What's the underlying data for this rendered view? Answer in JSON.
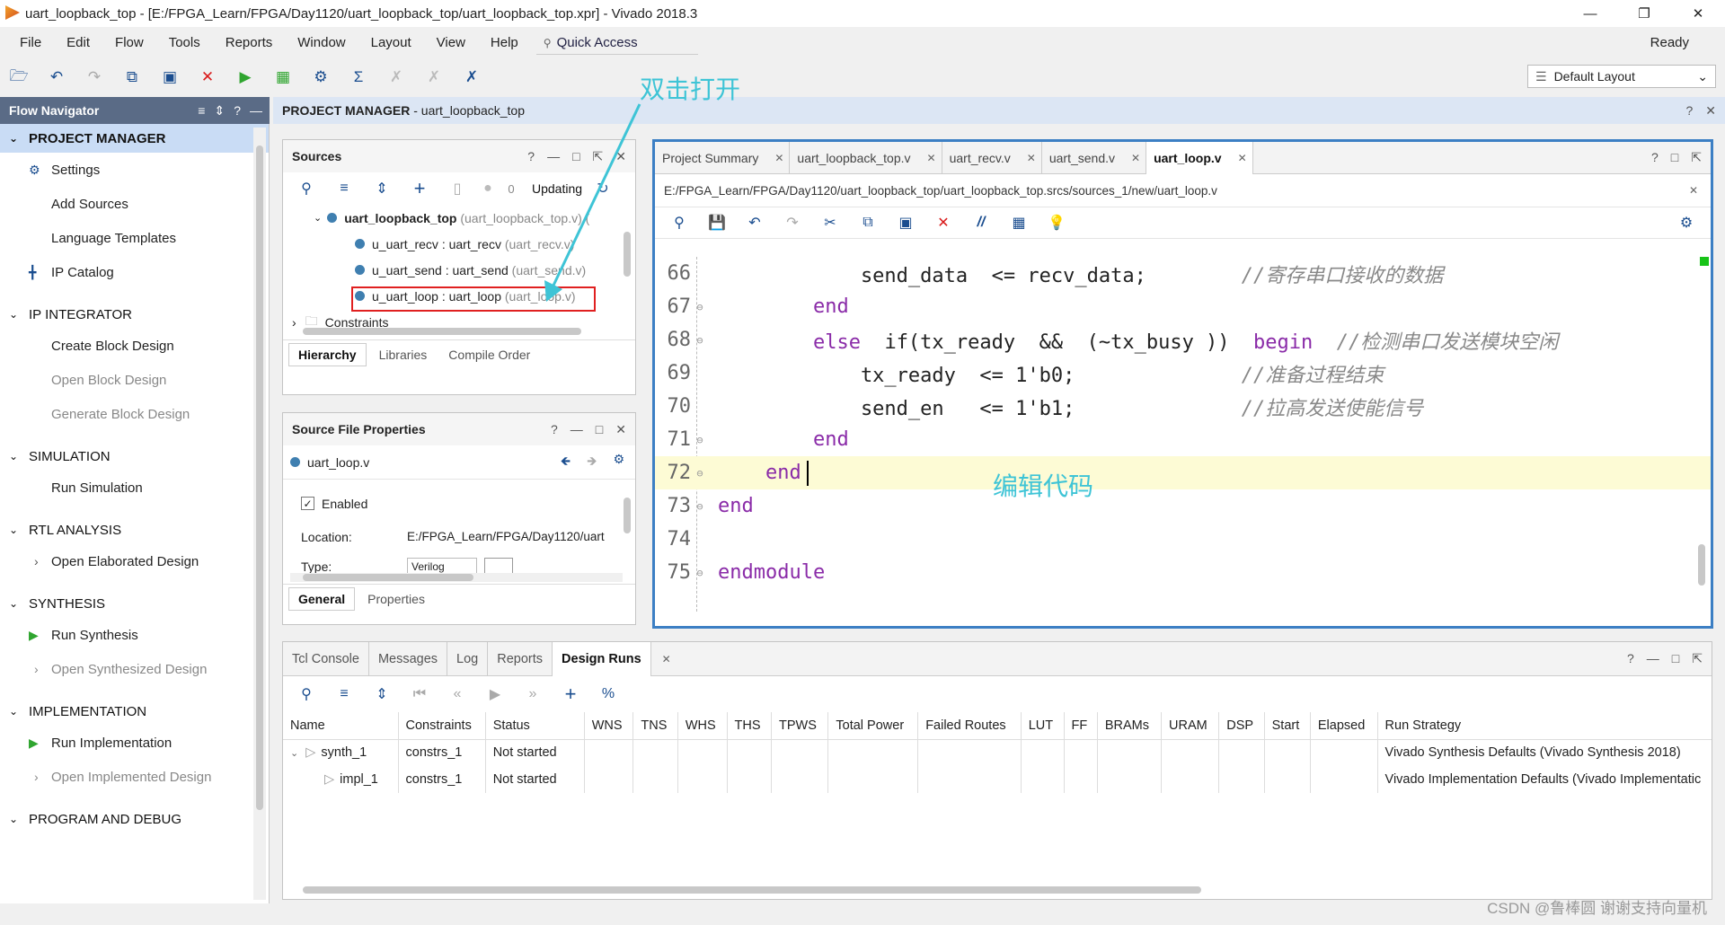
{
  "window": {
    "title": "uart_loopback_top - [E:/FPGA_Learn/FPGA/Day1120/uart_loopback_top/uart_loopback_top.xpr] - Vivado 2018.3",
    "min": "—",
    "max": "❐",
    "close": "✕"
  },
  "menu": [
    "File",
    "Edit",
    "Flow",
    "Tools",
    "Reports",
    "Window",
    "Layout",
    "View",
    "Help"
  ],
  "quick_access": "Quick Access",
  "status": "Ready",
  "layout_selector": "Default Layout",
  "flow_navigator": {
    "title": "Flow Navigator",
    "sections": [
      {
        "label": "PROJECT MANAGER",
        "items": [
          "Settings",
          "Add Sources",
          "Language Templates",
          "IP Catalog"
        ]
      },
      {
        "label": "IP INTEGRATOR",
        "items": [
          "Create Block Design",
          "Open Block Design",
          "Generate Block Design"
        ]
      },
      {
        "label": "SIMULATION",
        "items": [
          "Run Simulation"
        ]
      },
      {
        "label": "RTL ANALYSIS",
        "items": [
          "Open Elaborated Design"
        ]
      },
      {
        "label": "SYNTHESIS",
        "items": [
          "Run Synthesis",
          "Open Synthesized Design"
        ]
      },
      {
        "label": "IMPLEMENTATION",
        "items": [
          "Run Implementation",
          "Open Implemented Design"
        ]
      },
      {
        "label": "PROGRAM AND DEBUG",
        "items": []
      }
    ]
  },
  "pm_header": {
    "bold": "PROJECT MANAGER",
    "rest": " - uart_loopback_top"
  },
  "sources": {
    "title": "Sources",
    "count": "0",
    "updating": "Updating",
    "top": {
      "name": "uart_loopback_top",
      "file": " (uart_loopback_top.v) ("
    },
    "children": [
      {
        "name": "u_uart_recv : uart_recv",
        "file": " (uart_recv.v)"
      },
      {
        "name": "u_uart_send : uart_send",
        "file": " (uart_send.v)"
      },
      {
        "name": "u_uart_loop : uart_loop",
        "file": " (uart_loop.v)"
      }
    ],
    "constraints": "Constraints",
    "tabs": [
      "Hierarchy",
      "Libraries",
      "Compile Order"
    ]
  },
  "sfp": {
    "title": "Source File Properties",
    "file": "uart_loop.v",
    "enabled": "Enabled",
    "location_label": "Location:",
    "location_value": "E:/FPGA_Learn/FPGA/Day1120/uart",
    "type_label": "Type:",
    "type_value": "Verilog",
    "tabs": [
      "General",
      "Properties"
    ]
  },
  "editor": {
    "tabs": [
      "Project Summary",
      "uart_loopback_top.v",
      "uart_recv.v",
      "uart_send.v",
      "uart_loop.v"
    ],
    "path": "E:/FPGA_Learn/FPGA/Day1120/uart_loopback_top/uart_loopback_top.srcs/sources_1/new/uart_loop.v",
    "lines": [
      {
        "n": "66",
        "a": "            send_data  <= recv_data;",
        "c": "        //寄存串口接收的数据"
      },
      {
        "n": "67",
        "k": "        end"
      },
      {
        "n": "68",
        "k": "        else",
        "a": "  if(tx_ready  &&  (~tx_busy ))",
        "k2": "  begin",
        "c": "  //检测串口发送模块空闲"
      },
      {
        "n": "69",
        "a": "            tx_ready  <= 1'b0;",
        "c": "              //准备过程结束"
      },
      {
        "n": "70",
        "a": "            send_en   <= 1'b1;",
        "c": "              //拉高发送使能信号"
      },
      {
        "n": "71",
        "k": "        end"
      },
      {
        "n": "72",
        "k": "    end"
      },
      {
        "n": "73",
        "k": "end"
      },
      {
        "n": "74"
      },
      {
        "n": "75",
        "k": "endmodule"
      }
    ]
  },
  "annotations": {
    "double_click": "双击打开",
    "edit_code": "编辑代码"
  },
  "bottom": {
    "tabs": [
      "Tcl Console",
      "Messages",
      "Log",
      "Reports",
      "Design Runs"
    ],
    "columns": [
      "Name",
      "Constraints",
      "Status",
      "WNS",
      "TNS",
      "WHS",
      "THS",
      "TPWS",
      "Total Power",
      "Failed Routes",
      "LUT",
      "FF",
      "BRAMs",
      "URAM",
      "DSP",
      "Start",
      "Elapsed",
      "Run Strategy"
    ],
    "rows": [
      {
        "name": "synth_1",
        "constraints": "constrs_1",
        "status": "Not started",
        "strategy": "Vivado Synthesis Defaults (Vivado Synthesis 2018)"
      },
      {
        "name": "impl_1",
        "constraints": "constrs_1",
        "status": "Not started",
        "strategy": "Vivado Implementation Defaults (Vivado Implementatic"
      }
    ]
  },
  "watermark": "CSDN @鲁棒圆 谢谢支持向量机"
}
